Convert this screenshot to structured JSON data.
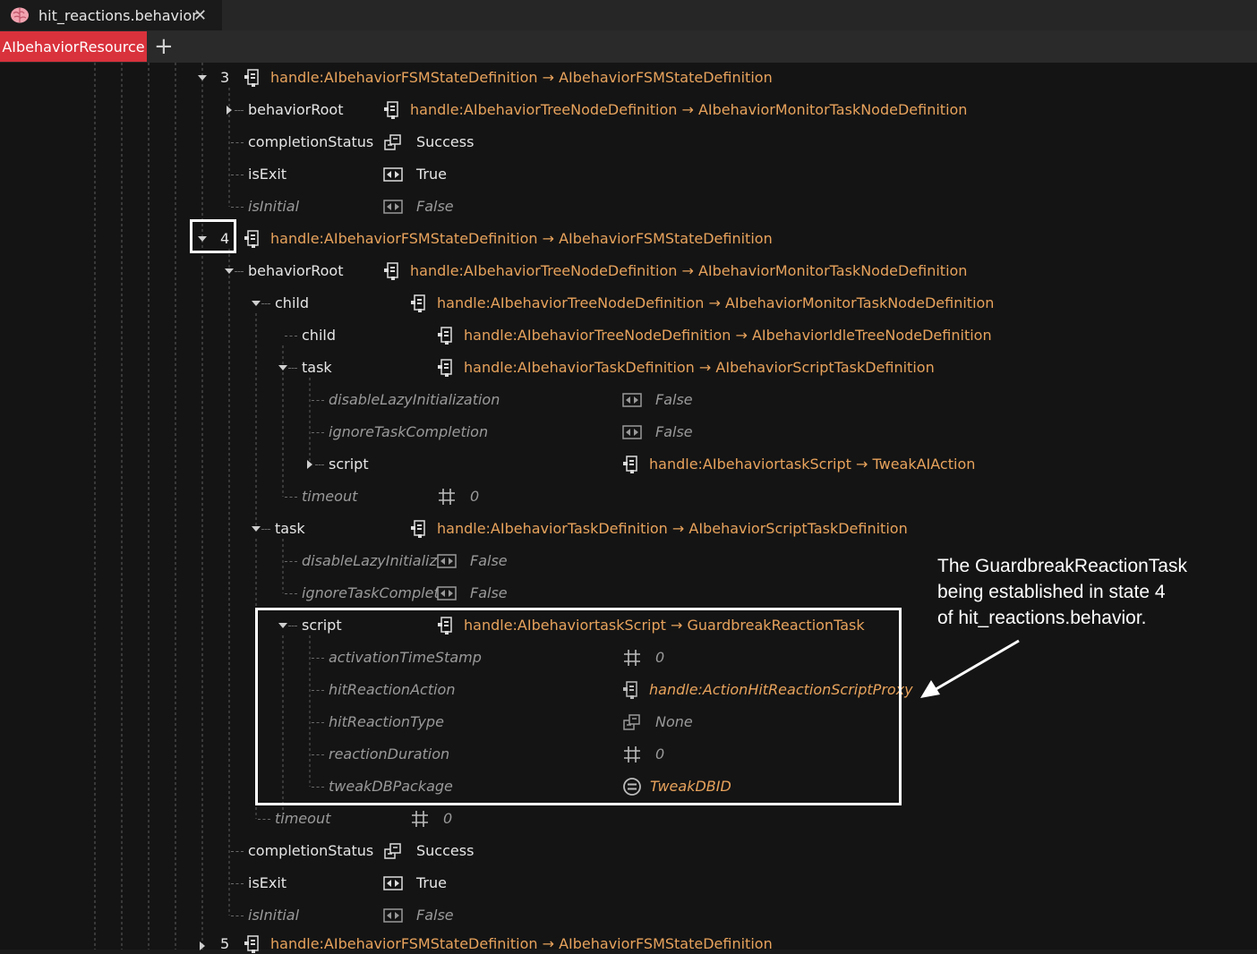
{
  "window": {
    "file_tab": "hit_reactions.behavior",
    "resource_tab": "AIbehaviorResource",
    "add_tab_symbol": "+",
    "close_symbol": "✕"
  },
  "rows": [
    {
      "id": "r3",
      "label": "3",
      "value": "handle:AIbehaviorFSMStateDefinition → AIbehaviorFSMStateDefinition"
    },
    {
      "id": "r3a",
      "label": "behaviorRoot",
      "value": "handle:AIbehaviorTreeNodeDefinition → AIbehaviorMonitorTaskNodeDefinition"
    },
    {
      "id": "r3b",
      "label": "completionStatus",
      "value": "Success"
    },
    {
      "id": "r3c",
      "label": "isExit",
      "value": "True"
    },
    {
      "id": "r3d",
      "label": "isInitial",
      "value": "False"
    },
    {
      "id": "r4",
      "label": "4",
      "value": "handle:AIbehaviorFSMStateDefinition → AIbehaviorFSMStateDefinition"
    },
    {
      "id": "r4a",
      "label": "behaviorRoot",
      "value": "handle:AIbehaviorTreeNodeDefinition → AIbehaviorMonitorTaskNodeDefinition"
    },
    {
      "id": "r4b",
      "label": "child",
      "value": "handle:AIbehaviorTreeNodeDefinition → AIbehaviorMonitorTaskNodeDefinition"
    },
    {
      "id": "r4c",
      "label": "child",
      "value": "handle:AIbehaviorTreeNodeDefinition → AIbehaviorIdleTreeNodeDefinition"
    },
    {
      "id": "r4d",
      "label": "task",
      "value": "handle:AIbehaviorTaskDefinition → AIbehaviorScriptTaskDefinition"
    },
    {
      "id": "r4e",
      "label": "disableLazyInitialization",
      "value": "False"
    },
    {
      "id": "r4f",
      "label": "ignoreTaskCompletion",
      "value": "False"
    },
    {
      "id": "r4g",
      "label": "script",
      "value": "handle:AIbehaviortaskScript → TweakAIAction"
    },
    {
      "id": "r4h",
      "label": "timeout",
      "value": "0"
    },
    {
      "id": "r4i",
      "label": "task",
      "value": "handle:AIbehaviorTaskDefinition → AIbehaviorScriptTaskDefinition"
    },
    {
      "id": "r4j",
      "label": "disableLazyInitializat",
      "value": "False"
    },
    {
      "id": "r4k",
      "label": "ignoreTaskCompletio",
      "value": "False"
    },
    {
      "id": "r4l",
      "label": "script",
      "value": "handle:AIbehaviortaskScript → GuardbreakReactionTask"
    },
    {
      "id": "r4m",
      "label": "activationTimeStamp",
      "value": "0"
    },
    {
      "id": "r4n",
      "label": "hitReactionAction",
      "value": "handle:ActionHitReactionScriptProxy"
    },
    {
      "id": "r4o",
      "label": "hitReactionType",
      "value": "None"
    },
    {
      "id": "r4p",
      "label": "reactionDuration",
      "value": "0"
    },
    {
      "id": "r4q",
      "label": "tweakDBPackage",
      "value": "TweakDBID"
    },
    {
      "id": "r4r",
      "label": "timeout",
      "value": "0"
    },
    {
      "id": "r4s",
      "label": "completionStatus",
      "value": "Success"
    },
    {
      "id": "r4t",
      "label": "isExit",
      "value": "True"
    },
    {
      "id": "r4u",
      "label": "isInitial",
      "value": "False"
    },
    {
      "id": "r5",
      "label": "5",
      "value": "handle:AIbehaviorFSMStateDefinition → AIbehaviorFSMStateDefinition"
    }
  ],
  "annotation": {
    "line1": "The GuardbreakReactionTask",
    "line2": "being established in state 4",
    "line3": "of hit_reactions.behavior."
  },
  "colors": {
    "handle_value": "#e8a35c",
    "highlight_tab": "#d9323c",
    "background": "#141414"
  }
}
